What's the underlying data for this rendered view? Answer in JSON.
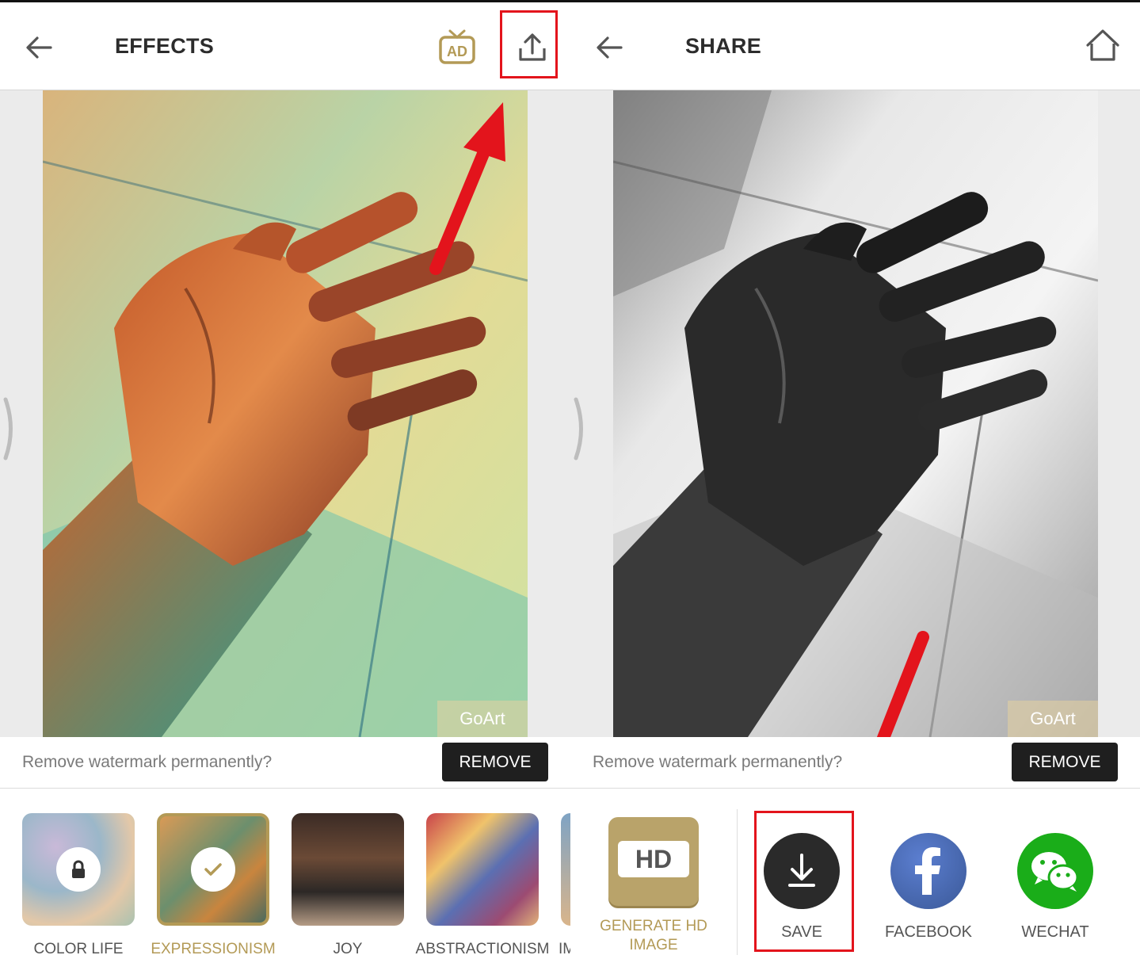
{
  "effects": {
    "title": "EFFECTS",
    "watermark": "GoArt",
    "watermark_prompt": "Remove watermark permanently?",
    "remove_label": "REMOVE",
    "styles": [
      {
        "label": "COLOR LIFE",
        "state": "locked"
      },
      {
        "label": "EXPRESSIONISM",
        "state": "selected"
      },
      {
        "label": "JOY",
        "state": "normal"
      },
      {
        "label": "ABSTRACTIONISM",
        "state": "normal"
      },
      {
        "label": "IM",
        "state": "partial"
      }
    ],
    "icons": [
      "back-arrow-icon",
      "ad-tv-icon",
      "share-upload-icon"
    ]
  },
  "share": {
    "title": "SHARE",
    "watermark": "GoArt",
    "watermark_prompt": "Remove watermark permanently?",
    "remove_label": "REMOVE",
    "hd_badge": "HD",
    "hd_label": "GENERATE HD IMAGE",
    "actions": [
      {
        "label": "SAVE",
        "icon": "download-icon",
        "color": "#2a2a2a"
      },
      {
        "label": "FACEBOOK",
        "icon": "facebook-icon",
        "color": "#3b5998"
      },
      {
        "label": "WECHAT",
        "icon": "wechat-icon",
        "color": "#1aad19"
      }
    ],
    "icons": [
      "back-arrow-icon",
      "home-icon"
    ]
  },
  "colors": {
    "accent_gold": "#b39a56",
    "highlight_red": "#e3141c",
    "dark_button": "#1f1f1f"
  }
}
